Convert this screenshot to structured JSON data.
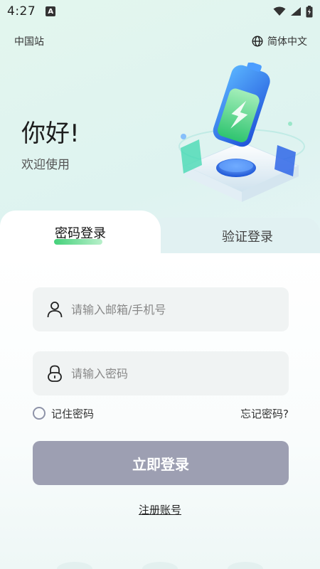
{
  "status_bar": {
    "time": "4:27",
    "app_icon_letter": "A",
    "icons": [
      "wifi-icon",
      "signal-icon",
      "battery-icon"
    ]
  },
  "header": {
    "region": "中国站",
    "language": "简体中文",
    "language_icon": "globe-icon"
  },
  "greeting": {
    "title": "你好!",
    "subtitle": "欢迎使用"
  },
  "tabs": [
    {
      "label": "密码登录",
      "active": true
    },
    {
      "label": "验证登录",
      "active": false
    }
  ],
  "form": {
    "account": {
      "placeholder": "请输入邮箱/手机号",
      "value": "",
      "icon": "user-icon"
    },
    "password": {
      "placeholder": "请输入密码",
      "value": "",
      "icon": "lock-icon"
    },
    "remember_label": "记住密码",
    "remember_checked": false,
    "forgot_label": "忘记密码?",
    "login_label": "立即登录",
    "register_label": "注册账号"
  },
  "colors": {
    "accent_green": "#44d17a",
    "login_button": "#9d9fb2",
    "field_bg": "#f0f3f3"
  }
}
